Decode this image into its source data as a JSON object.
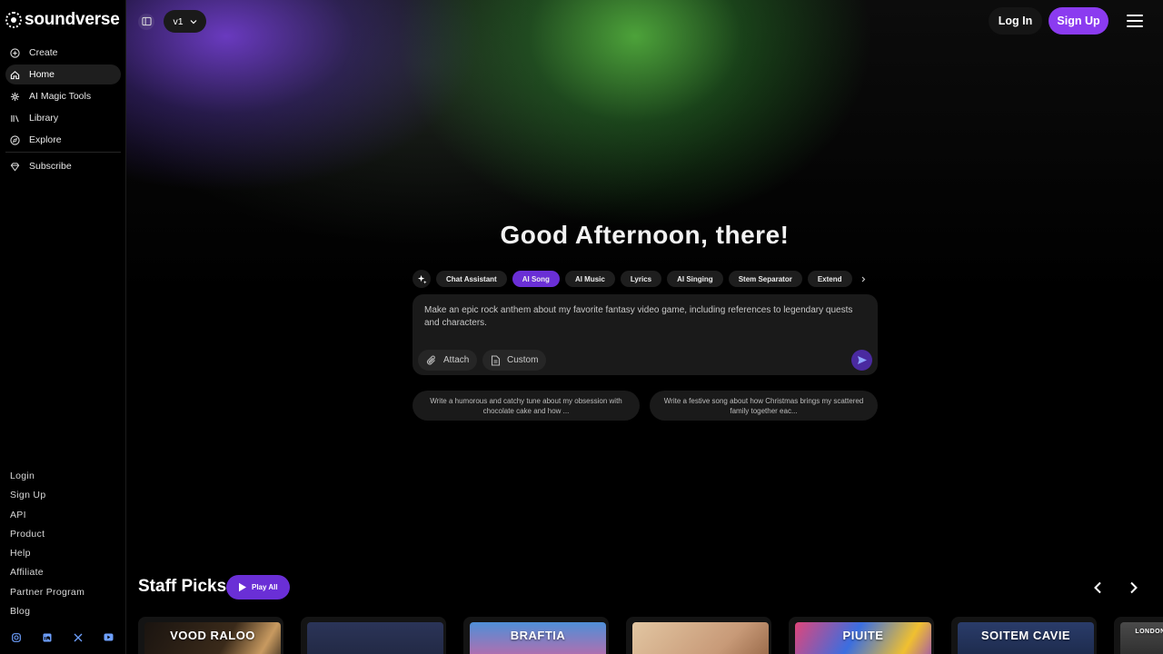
{
  "brand": {
    "name": "soundverse"
  },
  "sidebar": {
    "items": [
      {
        "label": "Create",
        "icon": "plus-circle-icon"
      },
      {
        "label": "Home",
        "icon": "home-icon",
        "active": true
      },
      {
        "label": "AI Magic Tools",
        "icon": "sparkle-icon"
      },
      {
        "label": "Library",
        "icon": "library-icon"
      },
      {
        "label": "Explore",
        "icon": "compass-icon"
      },
      {
        "label": "Subscribe",
        "icon": "diamond-icon"
      }
    ],
    "footer_links": [
      "Login",
      "Sign Up",
      "API",
      "Product",
      "Help",
      "Affiliate",
      "Partner Program",
      "Blog"
    ],
    "social_icons": [
      "instagram-icon",
      "linkedin-icon",
      "x-icon",
      "youtube-icon"
    ]
  },
  "topbar": {
    "version_label": "v1",
    "login_label": "Log In",
    "signup_label": "Sign Up"
  },
  "hero": {
    "greeting": "Good Afternoon, there!"
  },
  "tool_chips": [
    {
      "label": "Chat Assistant",
      "active": false
    },
    {
      "label": "AI Song",
      "active": true
    },
    {
      "label": "AI Music",
      "active": false
    },
    {
      "label": "Lyrics",
      "active": false
    },
    {
      "label": "AI Singing",
      "active": false
    },
    {
      "label": "Stem Separator",
      "active": false
    },
    {
      "label": "Extend",
      "active": false
    }
  ],
  "prompt": {
    "text": "Make an epic rock anthem about my favorite fantasy video game, including references to legendary quests and characters.",
    "attach_label": "Attach",
    "custom_label": "Custom"
  },
  "suggestions": [
    "Write a humorous and catchy tune about my obsession with chocolate cake and how ...",
    "Write a festive song about how Christmas brings my scattered family together eac..."
  ],
  "staff_picks": {
    "title": "Staff Picks",
    "play_all_label": "Play All",
    "cards": [
      {
        "title": "VOOD RALOO"
      },
      {
        "title": ""
      },
      {
        "title": "BRAFTIA"
      },
      {
        "title": ""
      },
      {
        "title": "PIUITE"
      },
      {
        "title": "SOITEM CAVIE"
      },
      {
        "title": "LONDON"
      }
    ]
  },
  "colors": {
    "accent": "#8b3bf0",
    "chip_active": "#6a2fd6",
    "surface": "#1a1a1a"
  }
}
